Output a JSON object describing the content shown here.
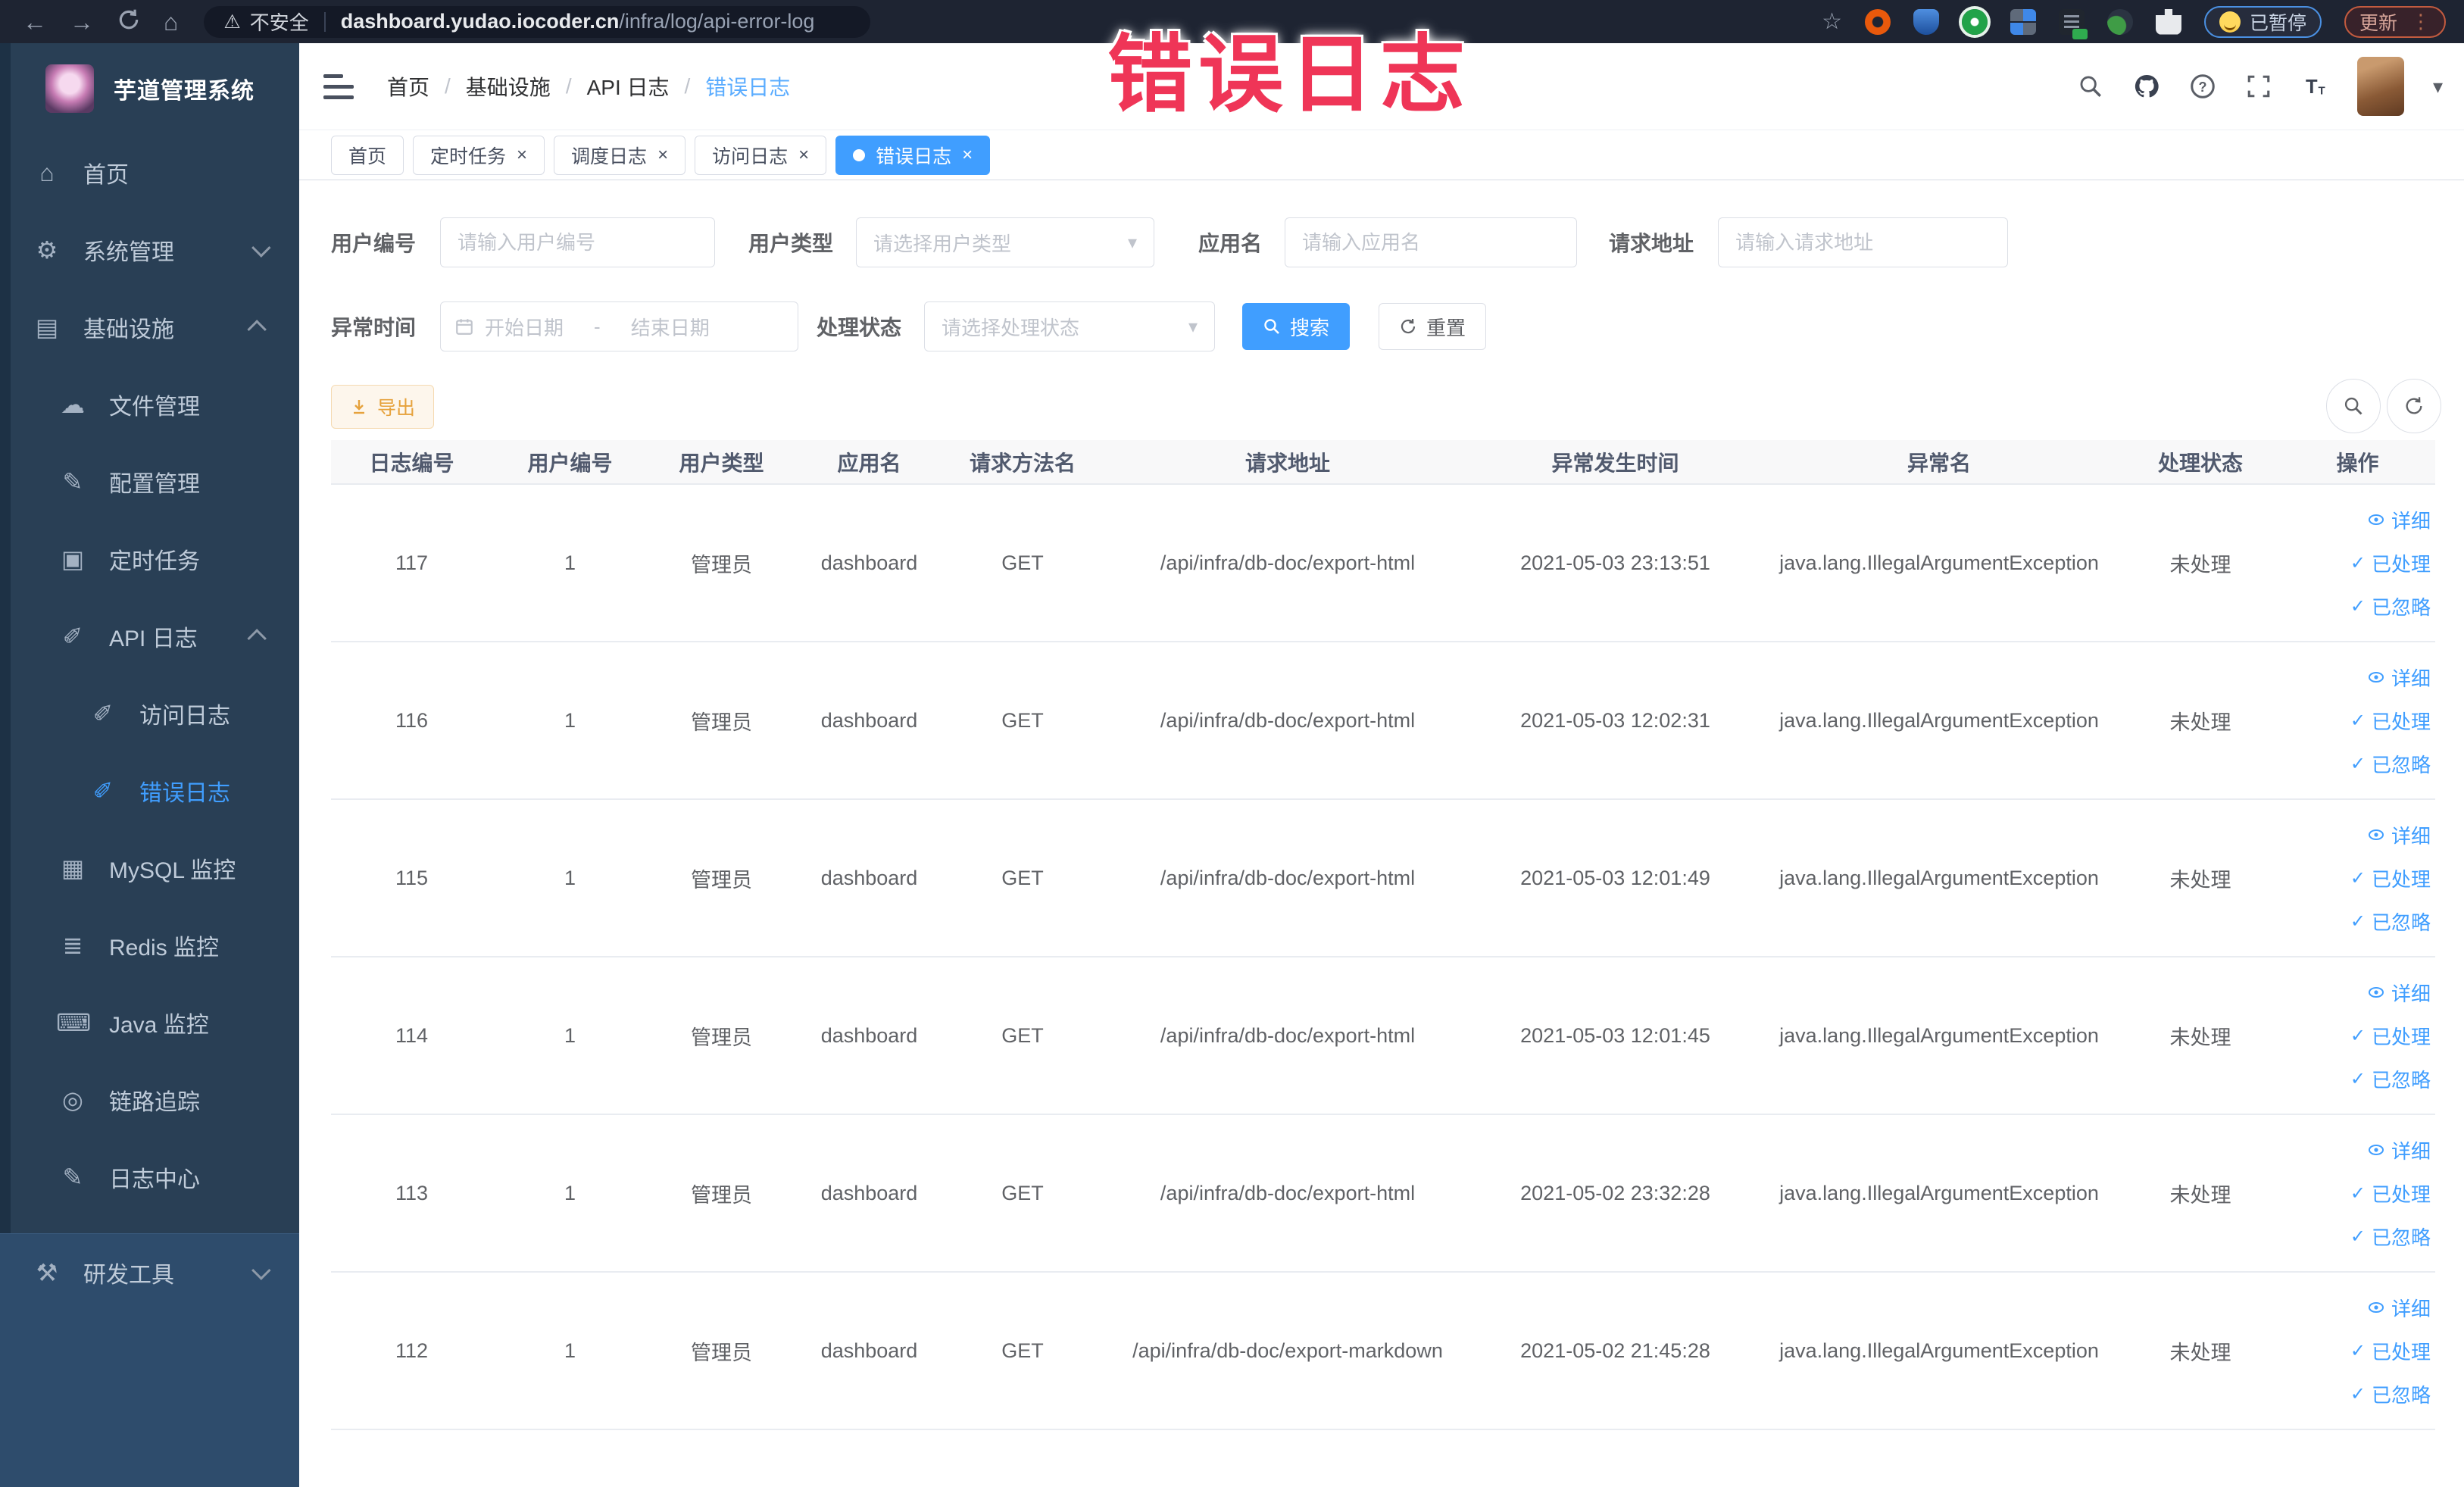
{
  "browser": {
    "security_label": "不安全",
    "url_host": "dashboard.yudao.iocoder.cn",
    "url_path": "/infra/log/api-error-log",
    "paused_badge": "已暂停",
    "update_badge": "更新"
  },
  "icons": {
    "back": "←",
    "forward": "→",
    "home": "⌂",
    "warning": "⚠",
    "star": "☆",
    "caret_down": "▾",
    "kebab": "⋮",
    "check": "✓",
    "close": "×"
  },
  "watermark": "错误日志",
  "sidebar": {
    "app_title": "芋道管理系统",
    "items": [
      {
        "key": "home",
        "label": "首页",
        "glyph": "⌂",
        "level": 0
      },
      {
        "key": "system-admin",
        "label": "系统管理",
        "glyph": "⚙",
        "level": 0,
        "chevron": "down"
      },
      {
        "key": "infrastructure",
        "label": "基础设施",
        "glyph": "▤",
        "level": 0,
        "chevron": "up"
      },
      {
        "key": "file-management",
        "label": "文件管理",
        "glyph": "☁",
        "level": 1
      },
      {
        "key": "config-management",
        "label": "配置管理",
        "glyph": "✎",
        "level": 1
      },
      {
        "key": "scheduled-tasks",
        "label": "定时任务",
        "glyph": "▣",
        "level": 1
      },
      {
        "key": "api-log",
        "label": "API 日志",
        "glyph": "✐",
        "level": 1,
        "chevron": "up"
      },
      {
        "key": "access-log",
        "label": "访问日志",
        "glyph": "✐",
        "level": 2
      },
      {
        "key": "error-log",
        "label": "错误日志",
        "glyph": "✐",
        "level": 2,
        "active": true
      },
      {
        "key": "mysql-monitor",
        "label": "MySQL 监控",
        "glyph": "▦",
        "level": 1
      },
      {
        "key": "redis-monitor",
        "label": "Redis 监控",
        "glyph": "≣",
        "level": 1
      },
      {
        "key": "java-monitor",
        "label": "Java 监控",
        "glyph": "⌨",
        "level": 1
      },
      {
        "key": "trace",
        "label": "链路追踪",
        "glyph": "◎",
        "level": 1
      },
      {
        "key": "log-center",
        "label": "日志中心",
        "glyph": "✎",
        "level": 1
      },
      {
        "key": "dev-tools",
        "label": "研发工具",
        "glyph": "⚒",
        "level": 0,
        "chevron": "down",
        "section": "bottom"
      }
    ]
  },
  "header": {
    "breadcrumb": [
      "首页",
      "基础设施",
      "API 日志",
      "错误日志"
    ]
  },
  "tabs": [
    {
      "key": "home",
      "label": "首页",
      "closable": false,
      "active": false
    },
    {
      "key": "scheduled-tasks",
      "label": "定时任务",
      "closable": true,
      "active": false
    },
    {
      "key": "schedule-log",
      "label": "调度日志",
      "closable": true,
      "active": false
    },
    {
      "key": "access-log",
      "label": "访问日志",
      "closable": true,
      "active": false
    },
    {
      "key": "error-log",
      "label": "错误日志",
      "closable": true,
      "active": true
    }
  ],
  "filters": {
    "user_id_label": "用户编号",
    "user_id_placeholder": "请输入用户编号",
    "user_type_label": "用户类型",
    "user_type_placeholder": "请选择用户类型",
    "app_name_label": "应用名",
    "app_name_placeholder": "请输入应用名",
    "request_url_label": "请求地址",
    "request_url_placeholder": "请输入请求地址",
    "exception_time_label": "异常时间",
    "date_start_placeholder": "开始日期",
    "date_separator": "-",
    "date_end_placeholder": "结束日期",
    "process_status_label": "处理状态",
    "process_status_placeholder": "请选择处理状态",
    "search_button": "搜索",
    "reset_button": "重置"
  },
  "toolbar": {
    "export_button": "导出"
  },
  "table": {
    "columns": [
      "日志编号",
      "用户编号",
      "用户类型",
      "应用名",
      "请求方法名",
      "请求地址",
      "异常发生时间",
      "异常名",
      "处理状态",
      "操作"
    ],
    "actions": [
      "详细",
      "已处理",
      "已忽略"
    ],
    "rows": [
      {
        "id": "117",
        "user_id": "1",
        "user_type": "管理员",
        "app": "dashboard",
        "method": "GET",
        "url": "/api/infra/db-doc/export-html",
        "time": "2021-05-03 23:13:51",
        "exception": "java.lang.IllegalArgumentException",
        "status": "未处理"
      },
      {
        "id": "116",
        "user_id": "1",
        "user_type": "管理员",
        "app": "dashboard",
        "method": "GET",
        "url": "/api/infra/db-doc/export-html",
        "time": "2021-05-03 12:02:31",
        "exception": "java.lang.IllegalArgumentException",
        "status": "未处理"
      },
      {
        "id": "115",
        "user_id": "1",
        "user_type": "管理员",
        "app": "dashboard",
        "method": "GET",
        "url": "/api/infra/db-doc/export-html",
        "time": "2021-05-03 12:01:49",
        "exception": "java.lang.IllegalArgumentException",
        "status": "未处理"
      },
      {
        "id": "114",
        "user_id": "1",
        "user_type": "管理员",
        "app": "dashboard",
        "method": "GET",
        "url": "/api/infra/db-doc/export-html",
        "time": "2021-05-03 12:01:45",
        "exception": "java.lang.IllegalArgumentException",
        "status": "未处理"
      },
      {
        "id": "113",
        "user_id": "1",
        "user_type": "管理员",
        "app": "dashboard",
        "method": "GET",
        "url": "/api/infra/db-doc/export-html",
        "time": "2021-05-02 23:32:28",
        "exception": "java.lang.IllegalArgumentException",
        "status": "未处理"
      },
      {
        "id": "112",
        "user_id": "1",
        "user_type": "管理员",
        "app": "dashboard",
        "method": "GET",
        "url": "/api/infra/db-doc/export-markdown",
        "time": "2021-05-02 21:45:28",
        "exception": "java.lang.IllegalArgumentException",
        "status": "未处理"
      }
    ]
  },
  "colors": {
    "primary": "#409eff",
    "warning": "#e6a23c",
    "watermark": "#ef3557"
  }
}
